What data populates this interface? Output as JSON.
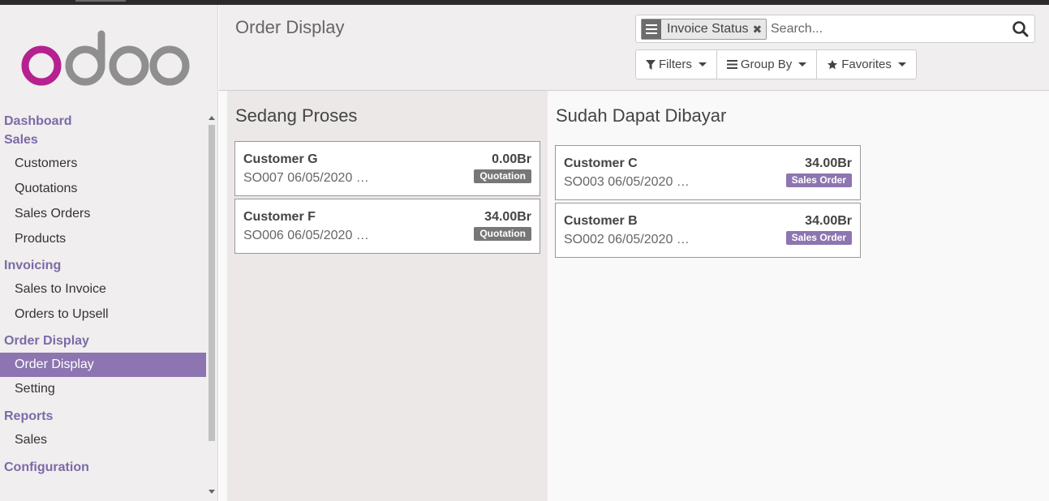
{
  "app": {
    "logo_text": "odoo",
    "logo_colors": {
      "o_first": "#b5218f",
      "rest": "#8f8f8f"
    }
  },
  "sidebar": {
    "groups": [
      {
        "label": "Dashboard",
        "items": []
      },
      {
        "label": "Sales",
        "items": [
          "Customers",
          "Quotations",
          "Sales Orders",
          "Products"
        ]
      },
      {
        "label": "Invoicing",
        "items": [
          "Sales to Invoice",
          "Orders to Upsell"
        ]
      },
      {
        "label": "Order Display",
        "items": [
          "Order Display",
          "Setting"
        ]
      },
      {
        "label": "Reports",
        "items": [
          "Sales"
        ]
      },
      {
        "label": "Configuration",
        "items": []
      }
    ],
    "active_item": "Order Display",
    "accent_color": "#8c75b0"
  },
  "control": {
    "title": "Order Display",
    "search": {
      "facet_label": "Invoice Status",
      "placeholder": "Search..."
    },
    "buttons": {
      "filters": "Filters",
      "group_by": "Group By",
      "favorites": "Favorites"
    }
  },
  "kanban": {
    "columns": [
      {
        "title": "Sedang Proses",
        "cards": [
          {
            "customer": "Customer G",
            "amount": "0.00Br",
            "ref": "SO007 06/05/2020 …",
            "status": "Quotation"
          },
          {
            "customer": "Customer F",
            "amount": "34.00Br",
            "ref": "SO006 06/05/2020 …",
            "status": "Quotation"
          }
        ]
      },
      {
        "title": "Sudah Dapat Dibayar",
        "cards": [
          {
            "customer": "Customer C",
            "amount": "34.00Br",
            "ref": "SO003 06/05/2020 …",
            "status": "Sales Order"
          },
          {
            "customer": "Customer B",
            "amount": "34.00Br",
            "ref": "SO002 06/05/2020 …",
            "status": "Sales Order"
          }
        ]
      }
    ],
    "status_colors": {
      "Quotation": "#777777",
      "Sales Order": "#8c75b0"
    }
  }
}
